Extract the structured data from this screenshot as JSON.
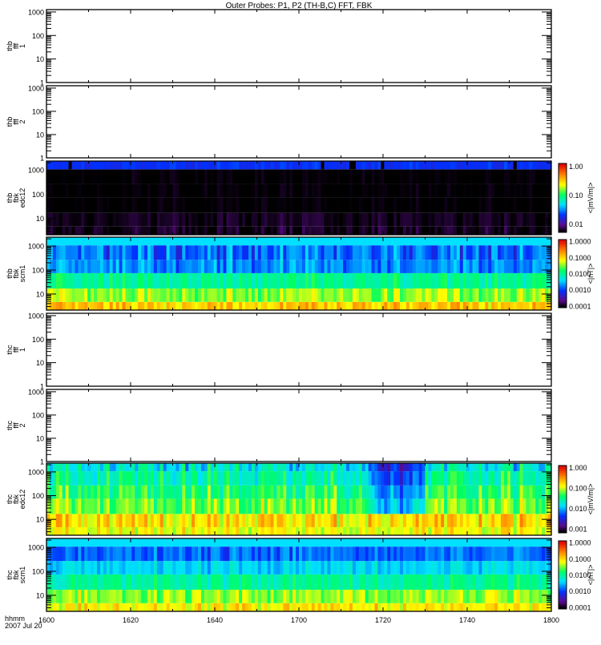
{
  "chart_data": {
    "type": "heatmap",
    "title": "Outer Probes: P1, P2 (TH-B,C) FFT, FBK",
    "x_axis": {
      "label_line1": "hhmm",
      "label_line2": "2007 Jul 20",
      "range_minutes": [
        0,
        120
      ],
      "ticks": [
        {
          "label": "1600",
          "minute": 0
        },
        {
          "label": "1620",
          "minute": 20
        },
        {
          "label": "1640",
          "minute": 40
        },
        {
          "label": "1700",
          "minute": 60
        },
        {
          "label": "1720",
          "minute": 80
        },
        {
          "label": "1740",
          "minute": 100
        },
        {
          "label": "1800",
          "minute": 120
        }
      ]
    },
    "panels": [
      {
        "label": [
          "thb",
          "fff",
          "1"
        ],
        "kind": "empty",
        "ylog_range": [
          0,
          3.1
        ],
        "yticks": [
          "1",
          "10",
          "100",
          "1000"
        ]
      },
      {
        "label": [
          "thb",
          "fff",
          "2"
        ],
        "kind": "empty",
        "ylog_range": [
          0,
          3.1
        ],
        "yticks": [
          "1",
          "10",
          "100",
          "1000"
        ]
      },
      {
        "label": [
          "thb",
          "fbk",
          "edc12"
        ],
        "kind": "spectrogram",
        "ylog_range": [
          0.33,
          3.37
        ],
        "yticks": [
          "10",
          "100",
          "1000"
        ],
        "band_edges_log10": [
          0.33,
          0.67,
          1.23,
          1.87,
          2.43,
          3.03,
          3.37
        ],
        "band_levels": [
          0.02,
          0.02,
          0.0,
          0.0,
          0.0,
          0.24
        ],
        "variability": [
          0.05,
          0.03,
          0.02,
          0.02,
          0.02,
          0.03
        ],
        "colorbar": {
          "unit": "<|mV/m|>",
          "ticks": [
            "1.00",
            "0.10",
            "0.01"
          ],
          "range_log10": [
            -2.3,
            0.1
          ]
        }
      },
      {
        "label": [
          "thb",
          "fbk",
          "scm1"
        ],
        "kind": "spectrogram",
        "ylog_range": [
          0.33,
          3.37
        ],
        "yticks": [
          "10",
          "100",
          "1000"
        ],
        "band_edges_log10": [
          0.33,
          0.67,
          1.23,
          1.87,
          2.43,
          3.03,
          3.37
        ],
        "band_levels": [
          0.76,
          0.63,
          0.5,
          0.33,
          0.3,
          0.4
        ],
        "variability": [
          0.08,
          0.08,
          0.07,
          0.08,
          0.1,
          0.0
        ],
        "colorbar": {
          "unit": "<|nT|>",
          "ticks": [
            "1.0000",
            "0.1000",
            "0.0100",
            "0.0010",
            "0.0001"
          ],
          "range_log10": [
            -4.1,
            0.1
          ]
        }
      },
      {
        "label": [
          "thc",
          "fff",
          "1"
        ],
        "kind": "empty",
        "ylog_range": [
          0,
          3.1
        ],
        "yticks": [
          "1",
          "10",
          "100",
          "1000"
        ]
      },
      {
        "label": [
          "thc",
          "fff",
          "2"
        ],
        "kind": "empty",
        "ylog_range": [
          0,
          3.1
        ],
        "yticks": [
          "1",
          "10",
          "100",
          "1000"
        ]
      },
      {
        "label": [
          "thc",
          "fbk",
          "edc12"
        ],
        "kind": "spectrogram",
        "ylog_range": [
          0.33,
          3.37
        ],
        "yticks": [
          "10",
          "100",
          "1000"
        ],
        "band_edges_log10": [
          0.33,
          0.67,
          1.23,
          1.87,
          2.43,
          3.03,
          3.37
        ],
        "band_levels": [
          0.7,
          0.74,
          0.62,
          0.56,
          0.5,
          0.44
        ],
        "variability": [
          0.08,
          0.1,
          0.1,
          0.1,
          0.1,
          0.12
        ],
        "quiet_interval_minutes": [
          76,
          90
        ],
        "colorbar": {
          "unit": "<|mV/m|>",
          "ticks": [
            "1.000",
            "0.100",
            "0.010",
            "0.001"
          ],
          "range_log10": [
            -3.2,
            0.1
          ]
        }
      },
      {
        "label": [
          "thc",
          "fbk",
          "scm1"
        ],
        "kind": "spectrogram",
        "ylog_range": [
          0.33,
          3.37
        ],
        "yticks": [
          "10",
          "100",
          "1000"
        ],
        "band_edges_log10": [
          0.33,
          0.67,
          1.23,
          1.87,
          2.43,
          3.03,
          3.37
        ],
        "band_levels": [
          0.72,
          0.64,
          0.5,
          0.4,
          0.3,
          0.4
        ],
        "variability": [
          0.08,
          0.08,
          0.07,
          0.06,
          0.07,
          0.0
        ],
        "colorbar": {
          "unit": "<|nT|>",
          "ticks": [
            "1.0000",
            "0.1000",
            "0.0100",
            "0.0010",
            "0.0001"
          ],
          "range_log10": [
            -4.1,
            0.1
          ]
        }
      }
    ]
  }
}
